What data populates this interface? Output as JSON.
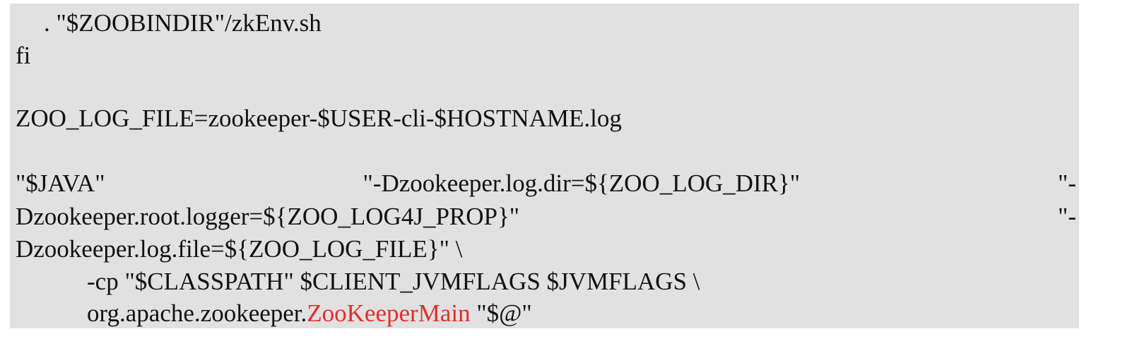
{
  "code": {
    "lines": [
      ". \"$ZOOBINDIR\"/zkEnv.sh",
      "fi",
      "",
      "ZOO_LOG_FILE=zookeeper-$USER-cli-$HOSTNAME.log",
      "",
      "",
      "",
      "Dzookeeper.log.file=${ZOO_LOG_FILE}\" \\",
      "-cp \"$CLASSPATH\" $CLIENT_JVMFLAGS $JVMFLAGS \\"
    ],
    "justified_line_1": {
      "part1": "\"$JAVA\"",
      "part2": "\"-Dzookeeper.log.dir=${ZOO_LOG_DIR}\"",
      "part3": "\"-"
    },
    "justified_line_2": {
      "part1": "Dzookeeper.root.logger=${ZOO_LOG4J_PROP}\"",
      "part2": "\"-"
    },
    "last_line": {
      "prefix": "org.apache.zookeeper.",
      "highlight": "ZooKeeperMain",
      "suffix": " \"$@\""
    },
    "highlight_color": "#e0302b",
    "background_color": "#e1e1e1"
  }
}
